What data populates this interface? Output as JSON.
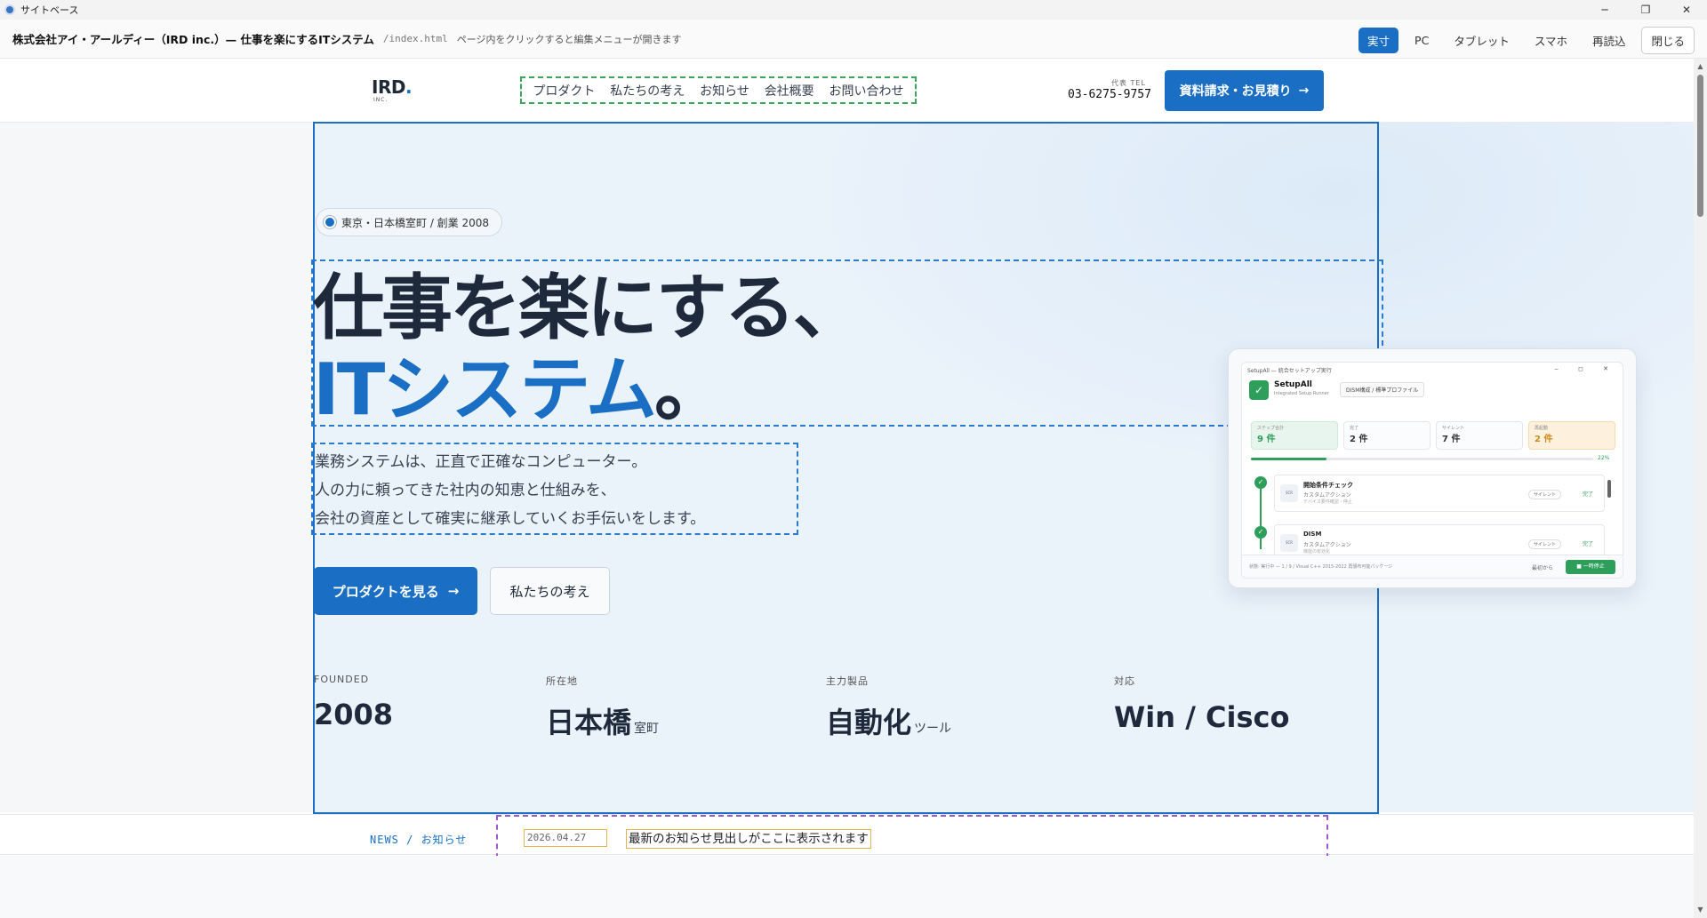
{
  "window": {
    "title": "サイトベース",
    "controls": {
      "minimize": "─",
      "maximize": "❐",
      "close": "✕"
    }
  },
  "editor": {
    "site_title": "株式会社アイ・アールディー（IRD inc.）— 仕事を楽にするITシステム",
    "file_path": "/index.html",
    "hint": "ページ内をクリックすると編集メニューが開きます",
    "view_modes": [
      "実寸",
      "PC",
      "タブレット",
      "スマホ"
    ],
    "active_view": "実寸",
    "reload_label": "再読込",
    "close_label": "閉じる"
  },
  "header": {
    "logo_text": "IRD",
    "logo_dot": ".",
    "logo_sub": "INC.",
    "nav": [
      "プロダクト",
      "私たちの考え",
      "お知らせ",
      "会社概要",
      "お問い合わせ"
    ],
    "tel_label": "代表 TEL",
    "tel_number": "03-6275-9757",
    "cta_label": "資料請求・お見積り",
    "cta_arrow": "→"
  },
  "hero": {
    "badge": "東京・日本橋室町 / 創業 2008",
    "headline_line1": "仕事を楽にする、",
    "headline_line2": "ITシステム",
    "headline_end": "。",
    "sub_lines": [
      "業務システムは、正直で正確なコンピューター。",
      "人の力に頼ってきた社内の知恵と仕組みを、",
      "会社の資産として確実に継承していくお手伝いをします。"
    ],
    "primary_button": "プロダクトを見る",
    "primary_arrow": "→",
    "secondary_button": "私たちの考え",
    "stats": [
      {
        "label": "FOUNDED",
        "value": "2008",
        "unit": ""
      },
      {
        "label": "所在地",
        "value": "日本橋",
        "unit": "室町"
      },
      {
        "label": "主力製品",
        "value": "自動化",
        "unit": "ツール"
      },
      {
        "label": "対応",
        "value": "Win / Cisco",
        "unit": ""
      }
    ]
  },
  "mockup": {
    "window_title": "SetupAll — 統合セットアップ実行",
    "controls": "‒ ◻ ✕",
    "app_icon": "✓",
    "app_name": "SetupAll",
    "app_sub": "Integrated Setup Runner",
    "profile": "DISM構成 / 標準プロファイル",
    "cards": [
      {
        "label": "ステップ合計",
        "value": "9 件"
      },
      {
        "label": "完了",
        "value": "2 件"
      },
      {
        "label": "サイレント",
        "value": "7 件"
      },
      {
        "label": "再起動",
        "value": "2 件"
      }
    ],
    "progress_percent": 22,
    "progress_label": "22%",
    "steps": [
      {
        "name": "開始条件チェック",
        "type": "カスタムアクション",
        "desc": "デバイス要件確認・停止",
        "mode": "サイレント",
        "status": "完了",
        "icon_text": "SCR"
      },
      {
        "name": "DISM",
        "type": "カスタムアクション",
        "desc": "機能の有効化",
        "mode": "サイレント",
        "status": "完了",
        "icon_text": "SCR"
      }
    ],
    "step_done_icon": "✓",
    "footer_text": "状態: 実行中 — 1 / 9 / Visual C++ 2015-2022 再頒布可能パッケージ",
    "footer_link": "最初から",
    "footer_button": "■ 一時停止"
  },
  "news": {
    "label": "NEWS / お知らせ",
    "date": "2026.04.27",
    "headline": "最新のお知らせ見出しがここに表示されます"
  },
  "colors": {
    "accent": "#1a6fc4",
    "success": "#2e9f5b",
    "nav_outline": "#3aa65a",
    "news_outline": "#9b59d0",
    "field_outline": "#e8b24a"
  }
}
